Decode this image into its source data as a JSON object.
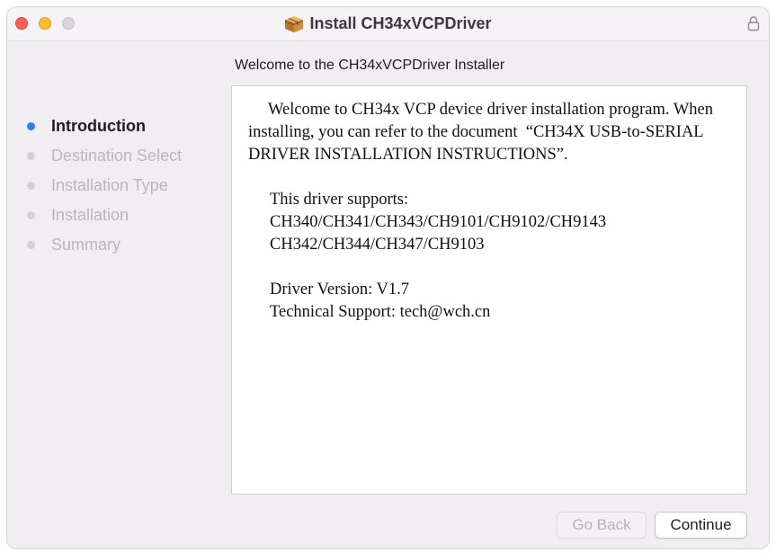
{
  "window": {
    "title": "Install CH34xVCPDriver",
    "title_icon": "package-icon",
    "lock_icon": "lock-icon",
    "traffic_lights": {
      "close_color": "#ff5f57",
      "minimize_color": "#febc2e",
      "zoom_color": "#d9d6d9"
    }
  },
  "header": {
    "subtitle": "Welcome to the CH34xVCPDriver Installer"
  },
  "sidebar": {
    "active_color": "#2e7df5",
    "steps": [
      {
        "label": "Introduction",
        "active": true
      },
      {
        "label": "Destination Select",
        "active": false
      },
      {
        "label": "Installation Type",
        "active": false
      },
      {
        "label": "Installation",
        "active": false
      },
      {
        "label": "Summary",
        "active": false
      }
    ]
  },
  "content": {
    "intro": "Welcome to CH34x VCP device driver installation program. When installing, you can refer to the document  “CH34X USB-to-SERIAL DRIVER INSTALLATION INSTRUCTIONS”.",
    "supports_heading": "This driver supports:",
    "supports_line1": "CH340/CH341/CH343/CH9101/CH9102/CH9143",
    "supports_line2": "CH342/CH344/CH347/CH9103",
    "driver_version": "Driver Version: V1.7",
    "technical_support": "Technical Support: tech@wch.cn"
  },
  "footer": {
    "go_back_label": "Go Back",
    "continue_label": "Continue"
  }
}
